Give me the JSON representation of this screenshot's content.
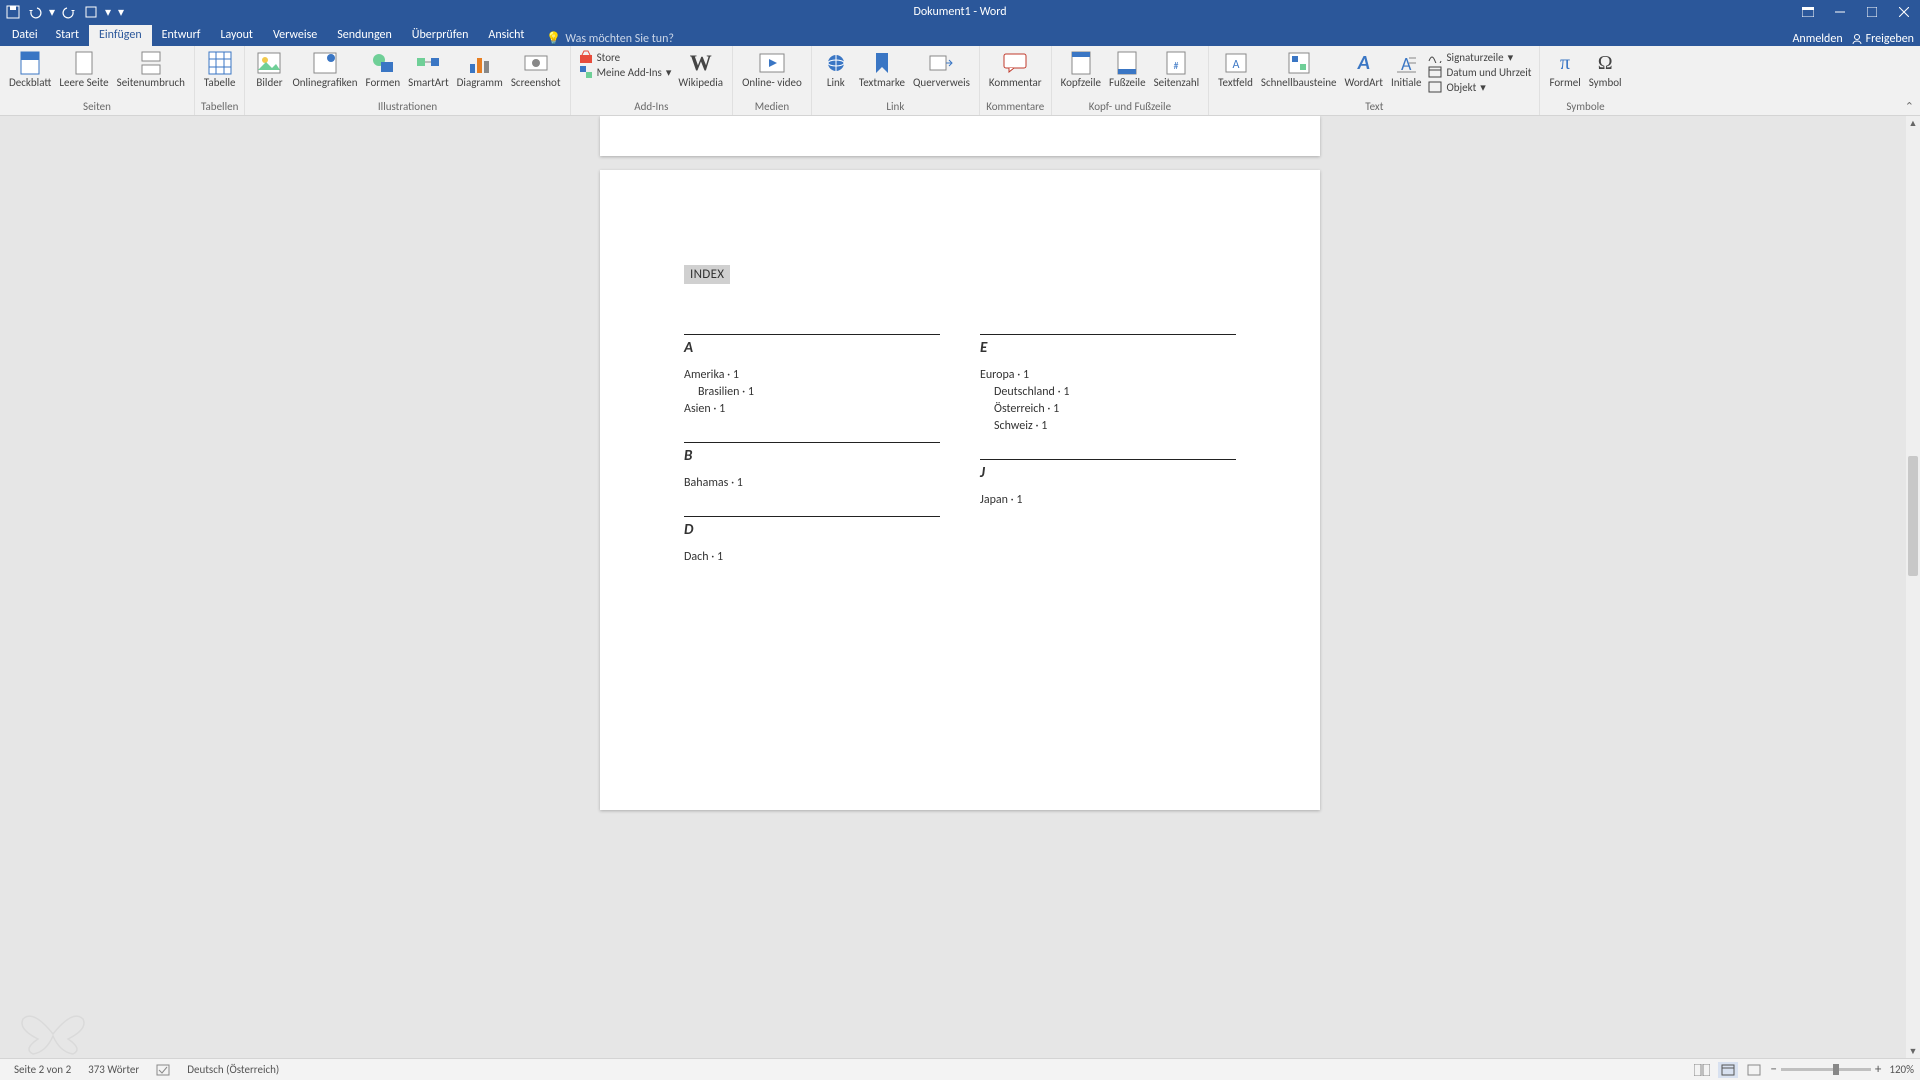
{
  "title": "Dokument1 - Word",
  "qat": {
    "save": "save-icon",
    "undo": "undo-icon",
    "redo": "redo-icon",
    "touch": "touch-icon",
    "more": "more-icon"
  },
  "tabs": {
    "items": [
      "Datei",
      "Start",
      "Einfügen",
      "Entwurf",
      "Layout",
      "Verweise",
      "Sendungen",
      "Überprüfen",
      "Ansicht"
    ],
    "active": 2,
    "tellme": "Was möchten Sie tun?",
    "signin": "Anmelden",
    "share": "Freigeben"
  },
  "ribbon": {
    "seiten": {
      "label": "Seiten",
      "deckblatt": "Deckblatt",
      "leere": "Leere\nSeite",
      "umbruch": "Seitenumbruch"
    },
    "tabellen": {
      "label": "Tabellen",
      "tabelle": "Tabelle"
    },
    "illustr": {
      "label": "Illustrationen",
      "bilder": "Bilder",
      "online": "Onlinegrafiken",
      "formen": "Formen",
      "smartart": "SmartArt",
      "diagramm": "Diagramm",
      "screenshot": "Screenshot"
    },
    "addins": {
      "label": "Add-Ins",
      "store": "Store",
      "meine": "Meine Add-Ins",
      "wiki": "Wikipedia"
    },
    "medien": {
      "label": "Medien",
      "video": "Online-\nvideo"
    },
    "link": {
      "label": "Link",
      "link": "Link",
      "textmarke": "Textmarke",
      "querverweis": "Querverweis"
    },
    "komm": {
      "label": "Kommentare",
      "kommentar": "Kommentar"
    },
    "kopf": {
      "label": "Kopf- und Fußzeile",
      "kopfzeile": "Kopfzeile",
      "fusszeile": "Fußzeile",
      "seitenzahl": "Seitenzahl"
    },
    "text": {
      "label": "Text",
      "textfeld": "Textfeld",
      "bausteine": "Schnellbausteine",
      "wordart": "WordArt",
      "initiale": "Initiale",
      "sig": "Signaturzeile",
      "datum": "Datum und Uhrzeit",
      "objekt": "Objekt"
    },
    "symb": {
      "label": "Symbole",
      "formel": "Formel",
      "symbol": "Symbol"
    }
  },
  "doc": {
    "index_label": "INDEX",
    "left": [
      {
        "letter": "A",
        "entries": [
          {
            "t": "Amerika · 1"
          },
          {
            "t": "Brasilien · 1",
            "sub": true
          },
          {
            "t": "Asien · 1"
          }
        ]
      },
      {
        "letter": "B",
        "entries": [
          {
            "t": "Bahamas · 1"
          }
        ]
      },
      {
        "letter": "D",
        "entries": [
          {
            "t": "Dach · 1"
          }
        ]
      }
    ],
    "right": [
      {
        "letter": "E",
        "entries": [
          {
            "t": "Europa · 1"
          },
          {
            "t": "Deutschland · 1",
            "sub": true
          },
          {
            "t": "Österreich · 1",
            "sub": true
          },
          {
            "t": "Schweiz · 1",
            "sub": true
          }
        ]
      },
      {
        "letter": "J",
        "entries": [
          {
            "t": "Japan · 1"
          }
        ]
      }
    ]
  },
  "status": {
    "page": "Seite 2 von 2",
    "words": "373 Wörter",
    "lang": "Deutsch (Österreich)",
    "zoom": "120%"
  }
}
